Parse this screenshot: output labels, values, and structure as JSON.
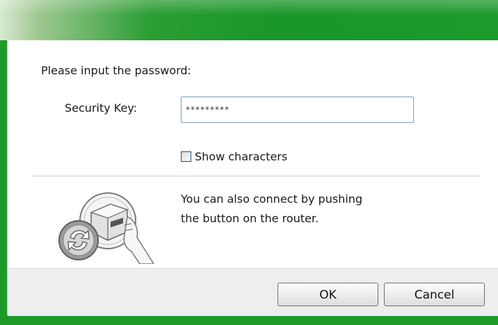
{
  "dialog": {
    "prompt": "Please input the password:",
    "security_key_label": "Security Key:",
    "security_key_value": "*********",
    "show_characters_label": "Show characters",
    "show_characters_checked": false,
    "info_line1": "You can also connect by pushing",
    "info_line2": "the button on the router.",
    "wps_icon": "wps-push-button-icon"
  },
  "buttons": {
    "ok_label": "OK",
    "cancel_label": "Cancel"
  },
  "colors": {
    "titlebar": "#1a962a",
    "footer": "#eeeeee"
  }
}
